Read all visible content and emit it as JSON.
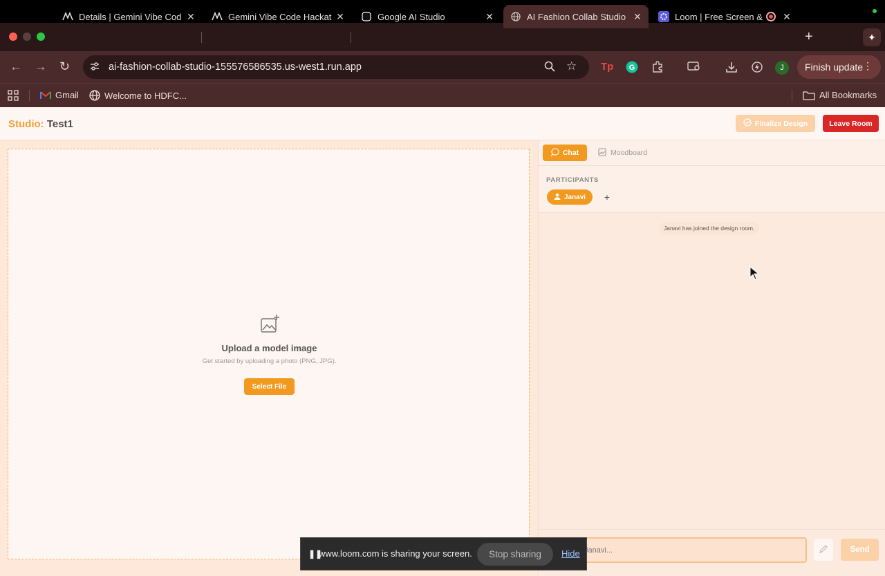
{
  "browser": {
    "tabs": [
      {
        "title": "Details | Gemini Vibe Cod",
        "active": false
      },
      {
        "title": "Gemini Vibe Code Hackat",
        "active": false
      },
      {
        "title": "Google AI Studio",
        "active": false
      },
      {
        "title": "AI Fashion Collab Studio",
        "active": true
      },
      {
        "title": "Loom | Free Screen &",
        "active": false
      }
    ],
    "url": "ai-fashion-collab-studio-155576586535.us-west1.run.app",
    "finish_update": "Finish update",
    "profile_initial": "J",
    "bookmarks": [
      {
        "label": "Gmail"
      },
      {
        "label": "Welcome to HDFC..."
      }
    ],
    "all_bookmarks": "All Bookmarks"
  },
  "app": {
    "studio_label": "Studio:",
    "studio_name": "Test1",
    "finalize_label": "Finalize Design",
    "leave_label": "Leave Room",
    "upload": {
      "title": "Upload a model image",
      "subtitle": "Get started by uploading a photo (PNG, JPG).",
      "button": "Select File"
    },
    "side": {
      "tab_chat": "Chat",
      "tab_moodboard": "Moodboard",
      "participants_label": "PARTICIPANTS",
      "participants": [
        {
          "name": "Janavi"
        }
      ],
      "add_label": "+",
      "system_message": "Janavi has joined the design room.",
      "input_placeholder": "Chat as Janavi...",
      "send_label": "Send"
    }
  },
  "loom": {
    "message": "www.loom.com is sharing your screen.",
    "stop_label": "Stop sharing",
    "hide_label": "Hide"
  },
  "colors": {
    "accent_orange": "#f29a20",
    "leave_red": "#d92626",
    "browser_frame": "#4a2a2a"
  }
}
